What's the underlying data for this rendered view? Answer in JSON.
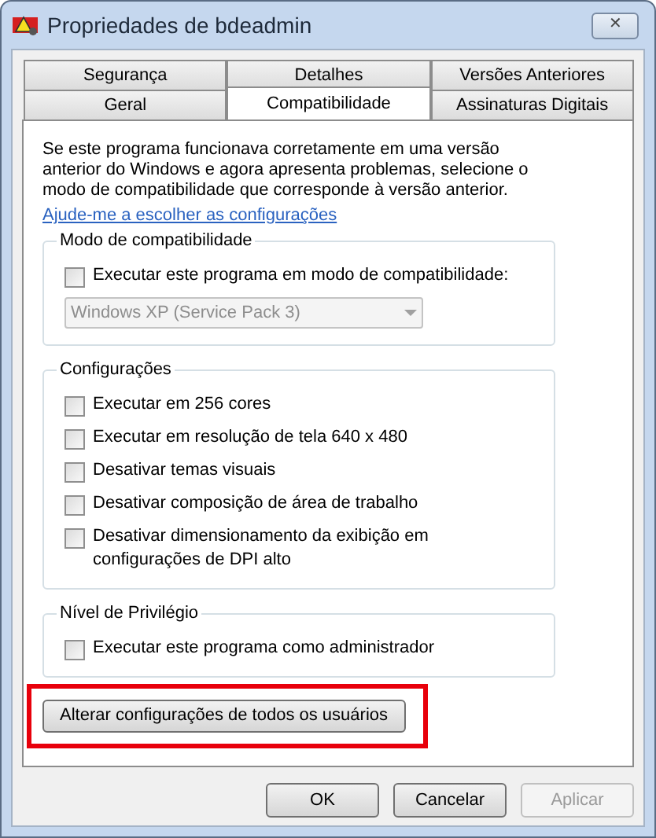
{
  "window": {
    "title": "Propriedades de bdeadmin",
    "close_symbol": "✕"
  },
  "tab_rows": [
    [
      {
        "label": "Segurança",
        "selected": false
      },
      {
        "label": "Detalhes",
        "selected": false
      },
      {
        "label": "Versões Anteriores",
        "selected": false
      }
    ],
    [
      {
        "label": "Geral",
        "selected": false
      },
      {
        "label": "Compatibilidade",
        "selected": true
      },
      {
        "label": "Assinaturas Digitais",
        "selected": false
      }
    ]
  ],
  "intro": "Se este programa funcionava corretamente em uma versão anterior do Windows e agora apresenta problemas, selecione o modo de compatibilidade que corresponde à versão anterior.",
  "help_link": "Ajude-me a escolher as configurações",
  "groups": [
    {
      "title": "Modo de compatibilidade",
      "items": [
        {
          "kind": "checkbox",
          "label": "Executar este programa em modo de compatibilidade:",
          "checked": false
        },
        {
          "kind": "dropdown",
          "value": "Windows XP (Service Pack 3)",
          "disabled": true
        }
      ]
    },
    {
      "title": "Configurações",
      "items": [
        {
          "kind": "checkbox",
          "label": "Executar em 256 cores",
          "checked": false
        },
        {
          "kind": "checkbox",
          "label": "Executar em resolução de tela 640 x 480",
          "checked": false
        },
        {
          "kind": "checkbox",
          "label": "Desativar temas visuais",
          "checked": false
        },
        {
          "kind": "checkbox",
          "label": "Desativar composição de área de trabalho",
          "checked": false
        },
        {
          "kind": "checkbox",
          "label": "Desativar dimensionamento da exibição em configurações de DPI alto",
          "checked": false
        }
      ]
    },
    {
      "title": "Nível de Privilégio",
      "items": [
        {
          "kind": "checkbox",
          "label": "Executar este programa como administrador",
          "checked": false
        }
      ]
    }
  ],
  "all_users_button": {
    "label": "Alterar configurações de todos os usuários",
    "highlighted": true
  },
  "buttons": [
    {
      "label": "OK",
      "disabled": false
    },
    {
      "label": "Cancelar",
      "disabled": false
    },
    {
      "label": "Aplicar",
      "disabled": true
    }
  ]
}
